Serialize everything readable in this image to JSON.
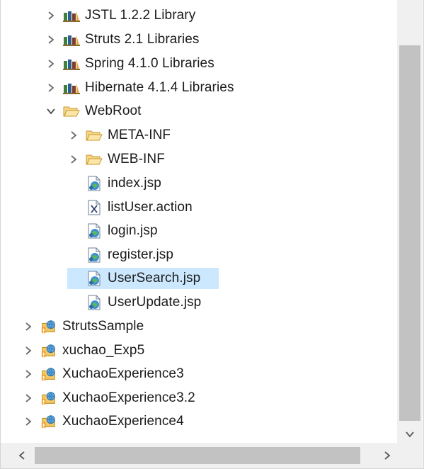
{
  "tree": {
    "items": [
      {
        "label": "JSTL 1.2.2 Library",
        "icon": "library-icon",
        "toggle": "collapsed"
      },
      {
        "label": "Struts 2.1 Libraries",
        "icon": "library-icon",
        "toggle": "collapsed"
      },
      {
        "label": "Spring 4.1.0 Libraries",
        "icon": "library-icon",
        "toggle": "collapsed"
      },
      {
        "label": "Hibernate 4.1.4 Libraries",
        "icon": "library-icon",
        "toggle": "collapsed"
      },
      {
        "label": "WebRoot",
        "icon": "folder-open-icon",
        "toggle": "expanded"
      },
      {
        "label": "META-INF",
        "icon": "folder-icon",
        "toggle": "collapsed"
      },
      {
        "label": "WEB-INF",
        "icon": "folder-icon",
        "toggle": "collapsed"
      },
      {
        "label": "index.jsp",
        "icon": "jsp-file-icon",
        "toggle": "none"
      },
      {
        "label": "listUser.action",
        "icon": "xml-file-icon",
        "toggle": "none"
      },
      {
        "label": "login.jsp",
        "icon": "jsp-file-icon",
        "toggle": "none"
      },
      {
        "label": "register.jsp",
        "icon": "jsp-file-icon",
        "toggle": "none"
      },
      {
        "label": "UserSearch.jsp",
        "icon": "jsp-file-icon",
        "toggle": "none",
        "selected": true
      },
      {
        "label": "UserUpdate.jsp",
        "icon": "jsp-file-icon",
        "toggle": "none"
      },
      {
        "label": "StrutsSample",
        "icon": "web-project-icon",
        "toggle": "collapsed"
      },
      {
        "label": "xuchao_Exp5",
        "icon": "web-project-icon",
        "toggle": "collapsed"
      },
      {
        "label": "XuchaoExperience3",
        "icon": "web-project-icon",
        "toggle": "collapsed"
      },
      {
        "label": "XuchaoExperience3.2",
        "icon": "web-project-icon",
        "toggle": "collapsed"
      },
      {
        "label": "XuchaoExperience4",
        "icon": "web-project-icon",
        "toggle": "collapsed"
      }
    ]
  },
  "colors": {
    "selection": "#cce8ff",
    "scroll_track": "#f0f0f0",
    "scroll_thumb": "#c2c2c2",
    "text": "#1b1b1b"
  }
}
